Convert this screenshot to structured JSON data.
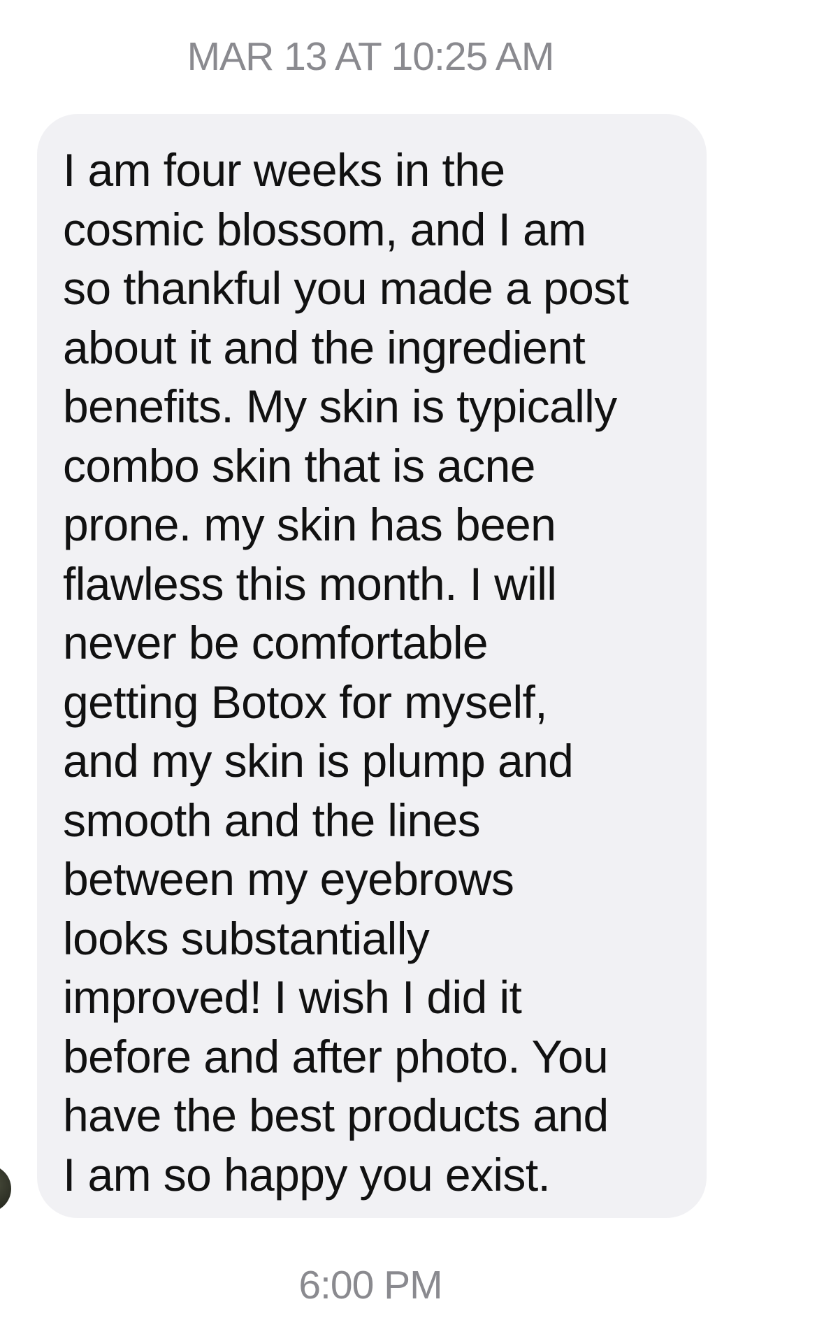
{
  "thread": {
    "timestamp_top": "MAR 13 AT 10:25 AM",
    "timestamp_bottom": "6:00 PM"
  },
  "message": {
    "lines": [
      "I am four weeks in the",
      "cosmic blossom, and I am",
      "so thankful you made a post",
      "about it and the ingredient",
      "benefits. My skin is typically",
      "combo skin that is acne",
      "prone. my skin has been",
      "flawless this month. I will",
      "never be comfortable",
      "getting Botox for myself,",
      "and my skin is plump and",
      "smooth and the lines",
      "between my eyebrows",
      "looks substantially",
      "improved! I wish I did it",
      "before and after photo. You",
      "have the best products and",
      "I am so happy you exist."
    ]
  },
  "colors": {
    "bubble_background": "#f1f1f4",
    "message_text": "#111111",
    "timestamp_text": "#8a8a8f",
    "page_background": "#ffffff"
  }
}
